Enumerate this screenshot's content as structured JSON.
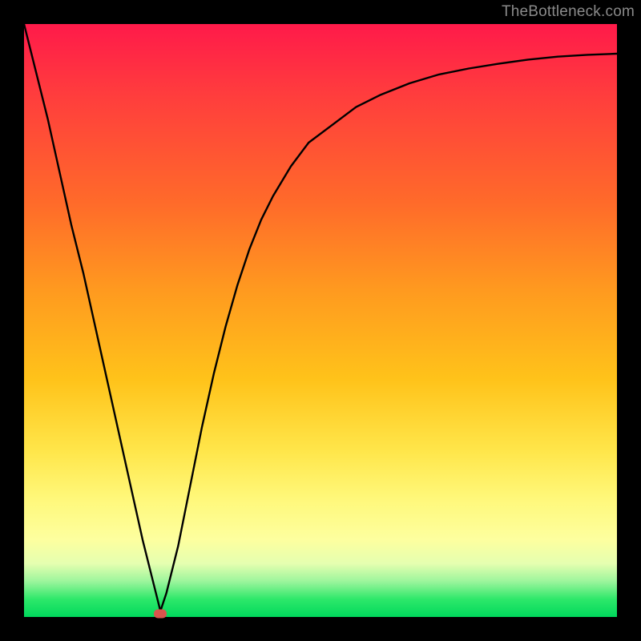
{
  "watermark": "TheBottleneck.com",
  "chart_data": {
    "type": "line",
    "title": "",
    "xlabel": "",
    "ylabel": "",
    "xlim": [
      0,
      100
    ],
    "ylim": [
      0,
      100
    ],
    "grid": false,
    "legend": false,
    "series": [
      {
        "name": "bottleneck-curve",
        "x": [
          0,
          2,
          4,
          6,
          8,
          10,
          12,
          14,
          16,
          18,
          20,
          22,
          23,
          24,
          26,
          28,
          30,
          32,
          34,
          36,
          38,
          40,
          42,
          45,
          48,
          52,
          56,
          60,
          65,
          70,
          75,
          80,
          85,
          90,
          95,
          100
        ],
        "values": [
          100,
          92,
          84,
          75,
          66,
          58,
          49,
          40,
          31,
          22,
          13,
          5,
          1,
          4,
          12,
          22,
          32,
          41,
          49,
          56,
          62,
          67,
          71,
          76,
          80,
          83,
          86,
          88,
          90,
          91.5,
          92.5,
          93.3,
          94,
          94.5,
          94.8,
          95
        ]
      }
    ],
    "marker": {
      "x": 23,
      "y": 0.5,
      "color": "#d9544d"
    },
    "background_gradient": {
      "top": "#ff1a4a",
      "mid": "#ffc31a",
      "bottom": "#00d85c"
    }
  }
}
